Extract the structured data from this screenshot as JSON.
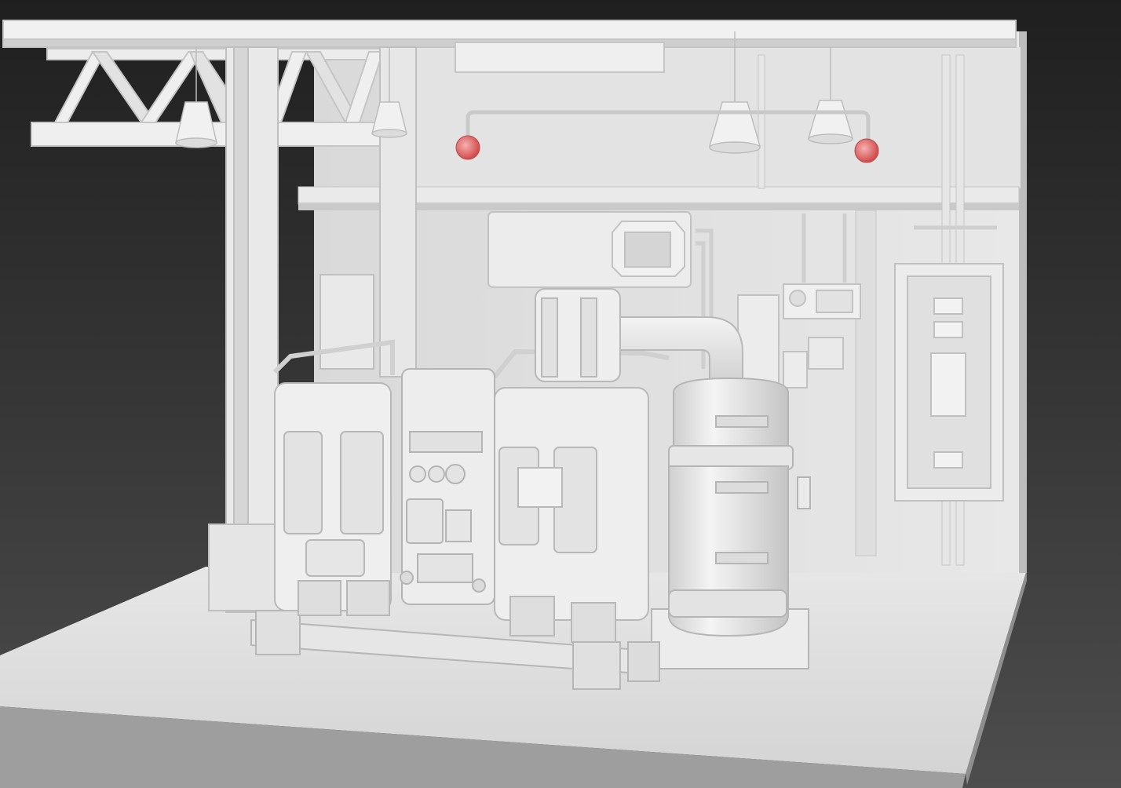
{
  "scene": {
    "background_top": "#1f1f1f",
    "background_bottom": "#4a4a4a",
    "clay_light": "#f2f2f2",
    "clay_mid": "#dcdcdc",
    "clay_shadow": "#b9b9b9",
    "clay_dark": "#9a9a9a",
    "alarm_light": "#e05a5a",
    "items": [
      "ground-slab",
      "back-wall",
      "steel-truss",
      "support-column",
      "pendant-lamp",
      "alarm-light",
      "vent-panel",
      "transformer-unit",
      "control-cabinet",
      "cooling-cylinder",
      "exhaust-pipe",
      "electrical-panel",
      "junction-box",
      "base-skid"
    ]
  }
}
